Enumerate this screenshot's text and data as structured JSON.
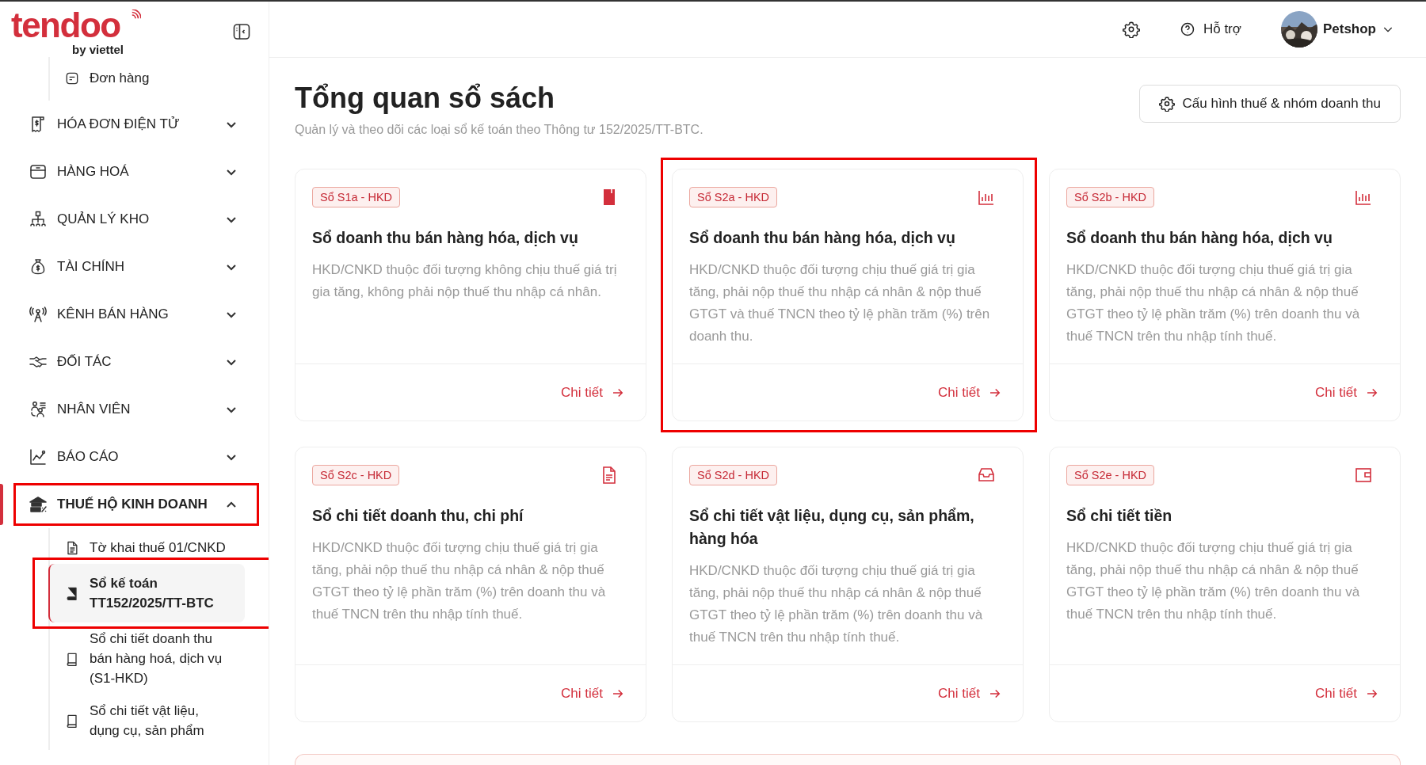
{
  "logo": {
    "wordmark": "tendoo",
    "byline": "by viettel"
  },
  "sidebar": {
    "top_children": [
      {
        "label": "Đơn hàng",
        "selected": false
      }
    ],
    "groups": [
      {
        "label": "HÓA ĐƠN ĐIỆN TỬ",
        "expanded": false,
        "selected": false,
        "highlighted": false
      },
      {
        "label": "HÀNG HOÁ",
        "expanded": false,
        "selected": false,
        "highlighted": false
      },
      {
        "label": "QUẢN LÝ KHO",
        "expanded": false,
        "selected": false,
        "highlighted": false
      },
      {
        "label": "TÀI CHÍNH",
        "expanded": false,
        "selected": false,
        "highlighted": false
      },
      {
        "label": "KÊNH BÁN HÀNG",
        "expanded": false,
        "selected": false,
        "highlighted": false
      },
      {
        "label": "ĐỐI TÁC",
        "expanded": false,
        "selected": false,
        "highlighted": false
      },
      {
        "label": "NHÂN VIÊN",
        "expanded": false,
        "selected": false,
        "highlighted": false
      },
      {
        "label": "BÁO CÁO",
        "expanded": false,
        "selected": false,
        "highlighted": false
      },
      {
        "label": "THUẾ HỘ KINH DOANH",
        "expanded": true,
        "selected": true,
        "highlighted": true,
        "children": [
          {
            "label": "Tờ khai thuế 01/CNKD",
            "selected": false,
            "highlighted": false
          },
          {
            "label": "Sổ kế toán TT152/2025/TT-BTC",
            "selected": true,
            "highlighted": true
          },
          {
            "label": "Sổ chi tiết doanh thu bán hàng hoá, dịch vụ (S1-HKD)",
            "selected": false,
            "highlighted": false
          },
          {
            "label": "Sổ chi tiết vật liệu, dụng cụ, sản phẩm",
            "selected": false,
            "highlighted": false
          }
        ]
      }
    ]
  },
  "header": {
    "support": "Hỗ trợ",
    "user": "Petshop"
  },
  "page": {
    "title": "Tổng quan sổ sách",
    "subtitle": "Quản lý và theo dõi các loại sổ kế toán theo Thông tư 152/2025/TT-BTC.",
    "config_button": "Cấu hình thuế & nhóm doanh thu"
  },
  "cards": [
    {
      "tag": "Sổ S1a - HKD",
      "title": "Sổ doanh thu bán hàng hóa, dịch vụ",
      "description": "HKD/CNKD thuộc đối tượng không chịu thuế giá trị gia tăng, không phải nộp thuế thu nhập cá nhân.",
      "link": "Chi tiết",
      "highlighted": false
    },
    {
      "tag": "Sổ S2a - HKD",
      "title": "Sổ doanh thu bán hàng hóa, dịch vụ",
      "description": "HKD/CNKD thuộc đối tượng chịu thuế giá trị gia tăng, phải nộp thuế thu nhập cá nhân & nộp thuế GTGT và thuế TNCN theo tỷ lệ phần trăm (%) trên doanh thu.",
      "link": "Chi tiết",
      "highlighted": true
    },
    {
      "tag": "Sổ S2b - HKD",
      "title": "Sổ doanh thu bán hàng hóa, dịch vụ",
      "description": "HKD/CNKD thuộc đối tượng chịu thuế giá trị gia tăng, phải nộp thuế thu nhập cá nhân & nộp thuế GTGT theo tỷ lệ phần trăm (%) trên doanh thu và thuế TNCN trên thu nhập tính thuế.",
      "link": "Chi tiết",
      "highlighted": false
    },
    {
      "tag": "Sổ S2c - HKD",
      "title": "Sổ chi tiết doanh thu, chi phí",
      "description": "HKD/CNKD thuộc đối tượng chịu thuế giá trị gia tăng, phải nộp thuế thu nhập cá nhân & nộp thuế GTGT theo tỷ lệ phần trăm (%) trên doanh thu và thuế TNCN trên thu nhập tính thuế.",
      "link": "Chi tiết",
      "highlighted": false
    },
    {
      "tag": "Sổ S2d - HKD",
      "title": "Sổ chi tiết vật liệu, dụng cụ, sản phẩm, hàng hóa",
      "description": "HKD/CNKD thuộc đối tượng chịu thuế giá trị gia tăng, phải nộp thuế thu nhập cá nhân & nộp thuế GTGT theo tỷ lệ phần trăm (%) trên doanh thu và thuế TNCN trên thu nhập tính thuế.",
      "link": "Chi tiết",
      "highlighted": false
    },
    {
      "tag": "Sổ S2e - HKD",
      "title": "Sổ chi tiết tiền",
      "description": "HKD/CNKD thuộc đối tượng chịu thuế giá trị gia tăng, phải nộp thuế thu nhập cá nhân & nộp thuế GTGT theo tỷ lệ phần trăm (%) trên doanh thu và thuế TNCN trên thu nhập tính thuế.",
      "link": "Chi tiết",
      "highlighted": false
    }
  ]
}
